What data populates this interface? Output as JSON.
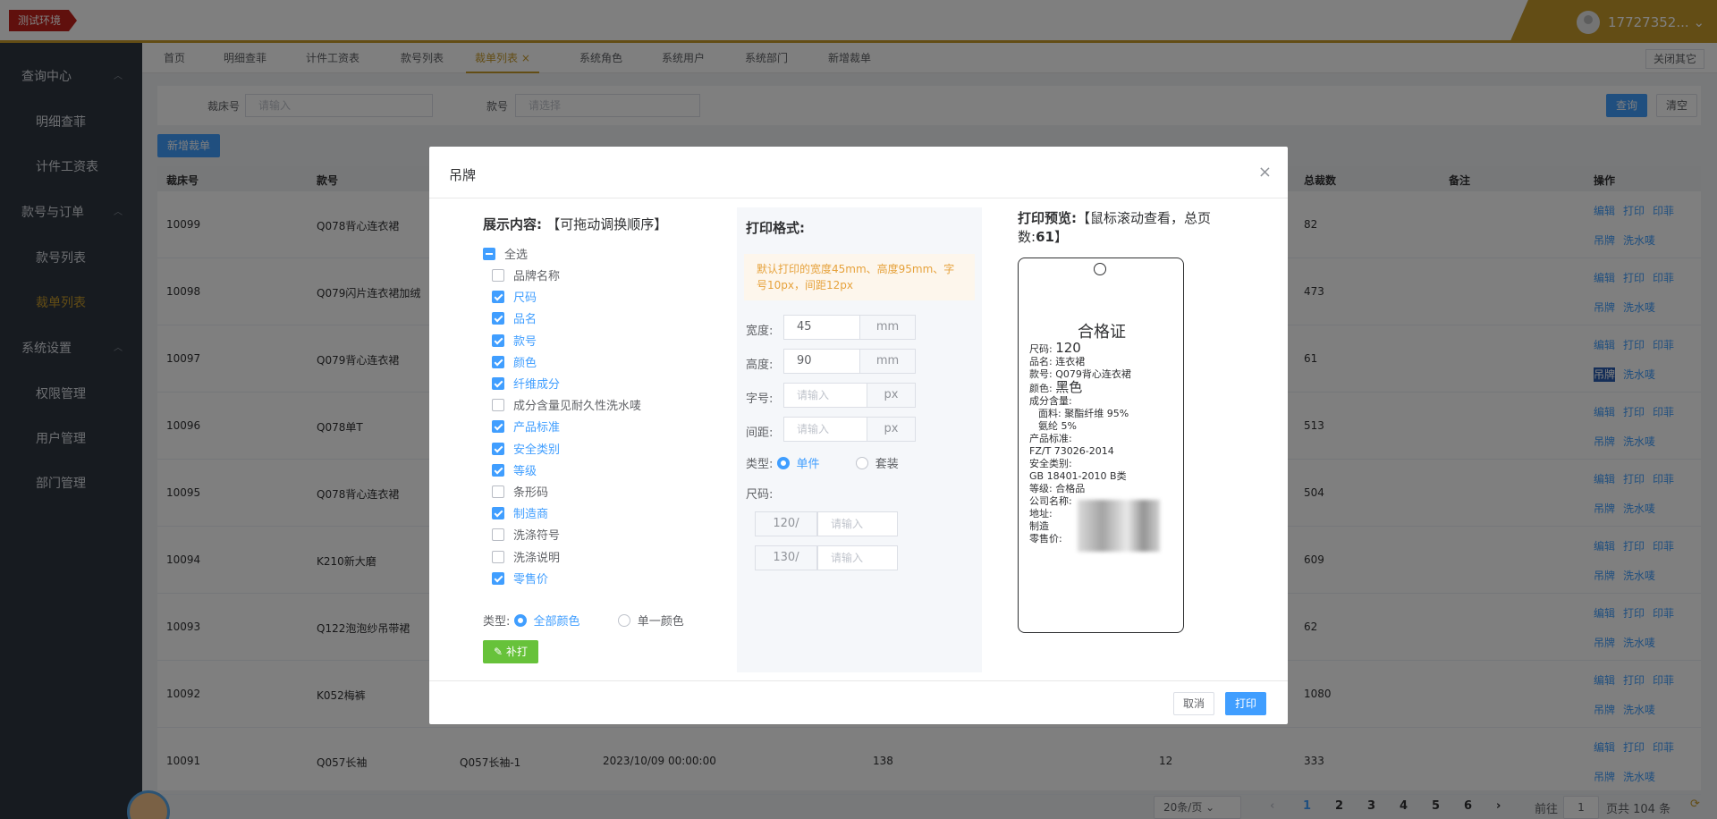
{
  "topbar": {
    "env_badge": "测试环境",
    "user_name": "17727352..."
  },
  "sidebar": {
    "groups": [
      {
        "label": "查询中心",
        "items": [
          "明细查菲",
          "计件工资表"
        ]
      },
      {
        "label": "款号与订单",
        "items": [
          "款号列表",
          "裁单列表"
        ]
      },
      {
        "label": "系统设置",
        "items": [
          "权限管理",
          "用户管理",
          "部门管理"
        ]
      }
    ],
    "active_item": "裁单列表"
  },
  "tabs": {
    "items": [
      "首页",
      "明细查菲",
      "计件工资表",
      "款号列表",
      "裁单列表",
      "系统角色",
      "系统用户",
      "系统部门",
      "新增裁单"
    ],
    "active": "裁单列表",
    "close_icon": "×",
    "close_others": "关闭其它"
  },
  "search": {
    "field1_label": "裁床号",
    "field1_placeholder": "请输入",
    "field2_label": "款号",
    "field2_placeholder": "请选择",
    "query_button": "查询",
    "clear_button": "清空",
    "add_button": "新增裁单"
  },
  "table": {
    "headers": {
      "bed_no": "裁床号",
      "style_no": "款号",
      "total": "总裁数",
      "remark": "备注",
      "ops": "操作"
    },
    "rows": [
      {
        "bed_no": "10099",
        "style_no": "Q078背心连衣裙",
        "col3": "",
        "date": "",
        "qty": "",
        "num": "",
        "total": "82"
      },
      {
        "bed_no": "10098",
        "style_no": "Q079闪片连衣裙加绒",
        "col3": "",
        "date": "",
        "qty": "",
        "num": "",
        "total": "473"
      },
      {
        "bed_no": "10097",
        "style_no": "Q079背心连衣裙",
        "col3": "",
        "date": "",
        "qty": "",
        "num": "",
        "total": "61"
      },
      {
        "bed_no": "10096",
        "style_no": "Q078单T",
        "col3": "",
        "date": "",
        "qty": "",
        "num": "",
        "total": "513"
      },
      {
        "bed_no": "10095",
        "style_no": "Q078背心连衣裙",
        "col3": "",
        "date": "",
        "qty": "",
        "num": "",
        "total": "504"
      },
      {
        "bed_no": "10094",
        "style_no": "K210新大磨",
        "col3": "",
        "date": "",
        "qty": "",
        "num": "",
        "total": "609"
      },
      {
        "bed_no": "10093",
        "style_no": "Q122泡泡纱吊带裙",
        "col3": "",
        "date": "",
        "qty": "",
        "num": "",
        "total": "62"
      },
      {
        "bed_no": "10092",
        "style_no": "K052梅裤",
        "col3": "",
        "date": "",
        "qty": "",
        "num": "",
        "total": "1080"
      },
      {
        "bed_no": "10091",
        "style_no": "Q057长袖",
        "col3": "Q057长袖-1",
        "date": "2023/10/09 00:00:00",
        "qty": "138",
        "num": "12",
        "total": "333"
      }
    ],
    "ops_labels": [
      "编辑",
      "打印",
      "印菲",
      "吊牌",
      "洗水唛"
    ]
  },
  "pagination": {
    "page_size": "20条/页",
    "prev": "‹",
    "pages": [
      "1",
      "2",
      "3",
      "4",
      "5",
      "6"
    ],
    "current": "1",
    "next": "›",
    "goto_label": "前往",
    "goto_value": "1",
    "total_label": "页共 104 条"
  },
  "dialog": {
    "title": "吊牌",
    "close_icon": "×",
    "display": {
      "title": "展示内容:",
      "hint": "【可拖动调换顺序】",
      "select_all": "全选",
      "fields": [
        {
          "label": "品牌名称",
          "checked": false
        },
        {
          "label": "尺码",
          "checked": true
        },
        {
          "label": "品名",
          "checked": true
        },
        {
          "label": "款号",
          "checked": true
        },
        {
          "label": "颜色",
          "checked": true
        },
        {
          "label": "纤维成分",
          "checked": true
        },
        {
          "label": "成分含量见耐久性洗水唛",
          "checked": false
        },
        {
          "label": "产品标准",
          "checked": true
        },
        {
          "label": "安全类别",
          "checked": true
        },
        {
          "label": "等级",
          "checked": true
        },
        {
          "label": "条形码",
          "checked": false
        },
        {
          "label": "制造商",
          "checked": true
        },
        {
          "label": "洗涤符号",
          "checked": false
        },
        {
          "label": "洗涤说明",
          "checked": false
        },
        {
          "label": "零售价",
          "checked": true
        }
      ],
      "type_label": "类型:",
      "type_options": [
        "全部颜色",
        "单一颜色"
      ],
      "type_selected": "全部颜色",
      "reprint_button": "补打"
    },
    "format": {
      "title": "打印格式:",
      "tip": "默认打印的宽度45mm、高度95mm、字号10px，间距12px",
      "width_label": "宽度:",
      "width_value": "45",
      "width_unit": "mm",
      "height_label": "高度:",
      "height_value": "90",
      "height_unit": "mm",
      "font_label": "字号:",
      "font_placeholder": "请输入",
      "font_unit": "px",
      "gap_label": "间距:",
      "gap_placeholder": "请输入",
      "gap_unit": "px",
      "type_label": "类型:",
      "type_options": [
        "单件",
        "套装"
      ],
      "type_selected": "单件",
      "size_label": "尺码:",
      "sizes": [
        {
          "size": "120/",
          "placeholder": "请输入"
        },
        {
          "size": "130/",
          "placeholder": "请输入"
        }
      ]
    },
    "preview": {
      "title": "打印预览:",
      "hint": "【鼠标滚动查看，总页数:",
      "total_pages": "61",
      "hint_end": "】",
      "tag_title": "合格证",
      "lines": {
        "size_label": "尺码:",
        "size_value": "120",
        "name": "品名: 连衣裙",
        "style": "款号: Q079背心连衣裙",
        "color_label": "颜色:",
        "color_value": "黑色",
        "composition": "成分含量:",
        "fabric": "面料: 聚酯纤维 95%",
        "spandex": "氨纶 5%",
        "standard_label": "产品标准:",
        "standard_value": "FZ/T 73026-2014",
        "safety_label": "安全类别:",
        "safety_value": "GB 18401-2010 B类",
        "grade": "等级: 合格品",
        "company": "公司名称:",
        "address": "地址:",
        "maker": "制造",
        "price": "零售价:"
      }
    },
    "cancel_button": "取消",
    "print_button": "打印"
  }
}
